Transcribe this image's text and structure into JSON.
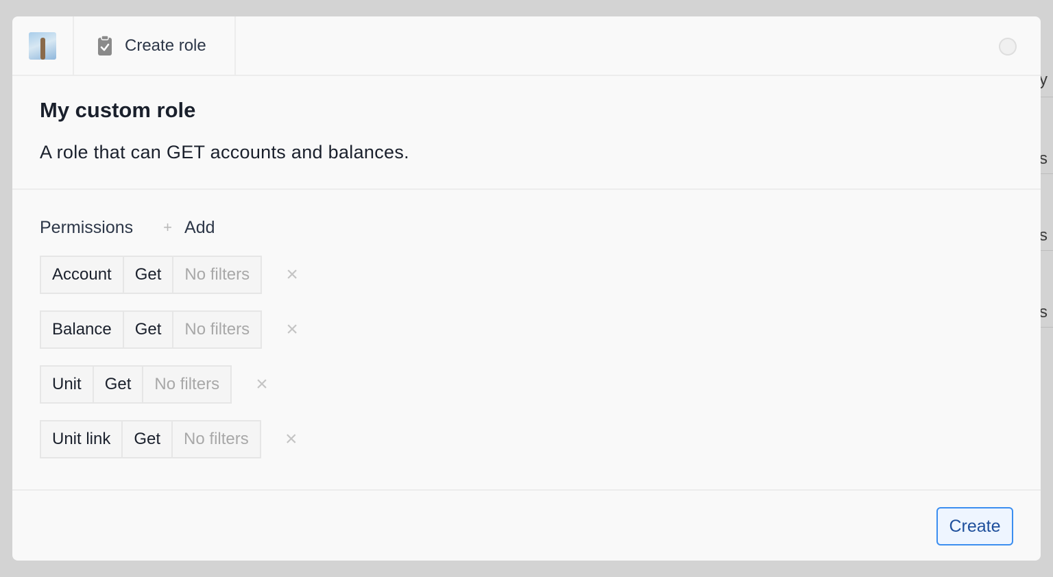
{
  "background_rows": [
    "y",
    "s",
    "s",
    "s"
  ],
  "header": {
    "avatar": "giraffe-avatar",
    "tab_label": "Create role"
  },
  "role": {
    "name": "My custom role",
    "description": "A role that can GET accounts and balances."
  },
  "permissions": {
    "heading": "Permissions",
    "add_label": "Add",
    "add_icon": "+",
    "remove_icon": "×",
    "items": [
      {
        "resource": "Account",
        "action": "Get",
        "filters": "No filters"
      },
      {
        "resource": "Balance",
        "action": "Get",
        "filters": "No filters"
      },
      {
        "resource": "Unit",
        "action": "Get",
        "filters": "No filters"
      },
      {
        "resource": "Unit link",
        "action": "Get",
        "filters": "No filters"
      }
    ]
  },
  "footer": {
    "create_label": "Create"
  },
  "colors": {
    "accent": "#3b8ef0",
    "accent_text": "#1e4f9c"
  }
}
